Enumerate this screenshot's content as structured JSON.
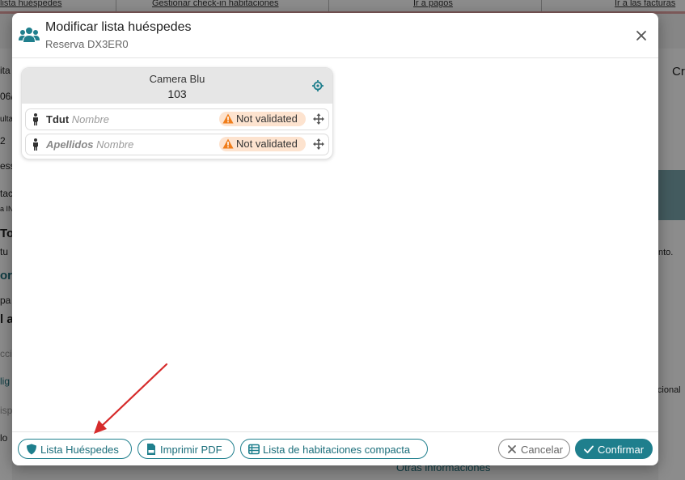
{
  "background": {
    "nav_links": [
      "lista huéspedes",
      "Gestionar check-in habitaciones",
      "Ir a pagos",
      "Ir a las facturas"
    ],
    "left_fragments": [
      "ita",
      "06/",
      "ulta",
      "2",
      "ess",
      "tac",
      "a IN",
      "To",
      "tu",
      "or",
      "pa",
      "l a",
      "ccio",
      "lig",
      "ispo",
      "lo"
    ],
    "right_fragments": [
      "Cr",
      "nto.",
      "licional"
    ],
    "bottom_text": "Otras informaciones"
  },
  "modal": {
    "title": "Modificar lista huéspedes",
    "subtitle": "Reserva DX3ER0",
    "room": {
      "name": "Camera Blu",
      "number": "103",
      "guests": [
        {
          "surname": "Tdut",
          "name_placeholder": "Nombre",
          "status": "Not validated"
        },
        {
          "surname": "Apellidos",
          "name_placeholder": "Nombre",
          "status": "Not validated"
        }
      ]
    },
    "footer": {
      "guest_list_label": "Lista Huéspedes",
      "print_pdf_label": "Imprimir PDF",
      "compact_list_label": "Lista de habitaciones compacta",
      "cancel_label": "Cancelar",
      "confirm_label": "Confirmar"
    }
  },
  "colors": {
    "accent": "#1f7f8d",
    "warning": "#f07d1a",
    "badge_bg": "#fde3cf",
    "annotation": "#d62b2b"
  }
}
